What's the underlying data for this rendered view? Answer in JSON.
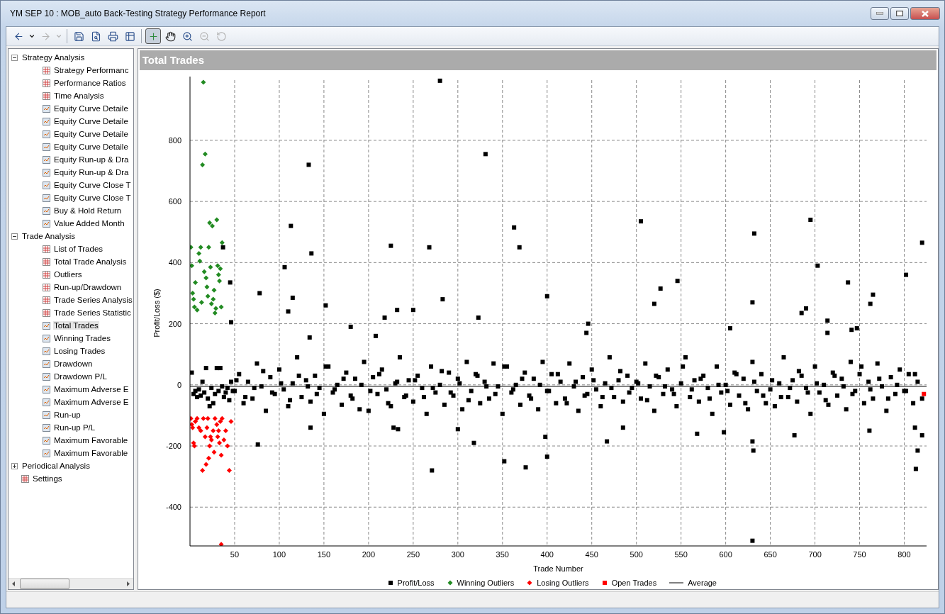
{
  "window": {
    "title": "YM   SEP 10 : MOB_auto Back-Testing Strategy Performance Report"
  },
  "toolbar": [
    {
      "kind": "back",
      "selected": false,
      "disabled": false
    },
    {
      "kind": "dropdown",
      "selected": false,
      "disabled": false
    },
    {
      "kind": "forward",
      "selected": false,
      "disabled": true
    },
    {
      "kind": "dropdown",
      "selected": false,
      "disabled": true
    },
    {
      "kind": "save",
      "selected": false,
      "disabled": false
    },
    {
      "kind": "preview",
      "selected": false,
      "disabled": false
    },
    {
      "kind": "print",
      "selected": false,
      "disabled": false
    },
    {
      "kind": "grid",
      "selected": false,
      "disabled": false
    },
    {
      "kind": "crosshair",
      "selected": true,
      "disabled": false
    },
    {
      "kind": "hand",
      "selected": false,
      "disabled": false
    },
    {
      "kind": "zoom-in",
      "selected": false,
      "disabled": false
    },
    {
      "kind": "zoom-out",
      "selected": false,
      "disabled": true
    },
    {
      "kind": "reset",
      "selected": false,
      "disabled": true
    }
  ],
  "sidebar": {
    "items": [
      {
        "label": "Strategy Analysis",
        "kind": "group",
        "expanded": true,
        "selected": false,
        "children": [
          {
            "label": "Strategy Performanc",
            "kind": "table",
            "selected": false
          },
          {
            "label": "Performance Ratios",
            "kind": "table",
            "selected": false
          },
          {
            "label": "Time Analysis",
            "kind": "table",
            "selected": false
          },
          {
            "label": "Equity Curve Detaile",
            "kind": "chart",
            "selected": false
          },
          {
            "label": "Equity Curve Detaile",
            "kind": "chart",
            "selected": false
          },
          {
            "label": "Equity Curve Detaile",
            "kind": "chart",
            "selected": false
          },
          {
            "label": "Equity Curve Detaile",
            "kind": "chart",
            "selected": false
          },
          {
            "label": "Equity Run-up & Dra",
            "kind": "chart",
            "selected": false
          },
          {
            "label": "Equity Run-up & Dra",
            "kind": "chart",
            "selected": false
          },
          {
            "label": "Equity Curve Close T",
            "kind": "chart",
            "selected": false
          },
          {
            "label": "Equity Curve Close T",
            "kind": "chart",
            "selected": false
          },
          {
            "label": "Buy & Hold Return",
            "kind": "chart",
            "selected": false
          },
          {
            "label": "Value Added Month",
            "kind": "chart",
            "selected": false
          }
        ]
      },
      {
        "label": "Trade Analysis",
        "kind": "group",
        "expanded": true,
        "selected": false,
        "children": [
          {
            "label": "List of Trades",
            "kind": "table",
            "selected": false
          },
          {
            "label": "Total Trade Analysis",
            "kind": "table",
            "selected": false
          },
          {
            "label": "Outliers",
            "kind": "table",
            "selected": false
          },
          {
            "label": "Run-up/Drawdown",
            "kind": "table",
            "selected": false
          },
          {
            "label": "Trade Series Analysis",
            "kind": "table",
            "selected": false
          },
          {
            "label": "Trade Series Statistic",
            "kind": "table",
            "selected": false
          },
          {
            "label": "Total Trades",
            "kind": "chart",
            "selected": true
          },
          {
            "label": "Winning Trades",
            "kind": "chart",
            "selected": false
          },
          {
            "label": "Losing Trades",
            "kind": "chart",
            "selected": false
          },
          {
            "label": "Drawdown",
            "kind": "chart",
            "selected": false
          },
          {
            "label": "Drawdown P/L",
            "kind": "chart",
            "selected": false
          },
          {
            "label": "Maximum Adverse E",
            "kind": "chart",
            "selected": false
          },
          {
            "label": "Maximum Adverse E",
            "kind": "chart",
            "selected": false
          },
          {
            "label": "Run-up",
            "kind": "chart",
            "selected": false
          },
          {
            "label": "Run-up P/L",
            "kind": "chart",
            "selected": false
          },
          {
            "label": "Maximum Favorable",
            "kind": "chart",
            "selected": false
          },
          {
            "label": "Maximum Favorable",
            "kind": "chart",
            "selected": false
          }
        ]
      },
      {
        "label": "Periodical Analysis",
        "kind": "group",
        "expanded": false,
        "selected": false
      },
      {
        "label": "Settings",
        "kind": "table",
        "selected": false
      }
    ]
  },
  "report": {
    "title": "Total Trades",
    "chart_data": {
      "type": "scatter",
      "grid": true,
      "xlabel": "Trade Number",
      "ylabel": "Profit/Loss ($)",
      "xlim": [
        0,
        825
      ],
      "ylim": [
        -527,
        997
      ],
      "xticks": [
        {
          "value": 50,
          "label": "50"
        },
        {
          "value": 100,
          "label": "100"
        },
        {
          "value": 150,
          "label": "150"
        },
        {
          "value": 200,
          "label": "200"
        },
        {
          "value": 250,
          "label": "250"
        },
        {
          "value": 300,
          "label": "300"
        },
        {
          "value": 350,
          "label": "350"
        },
        {
          "value": 400,
          "label": "400"
        },
        {
          "value": 450,
          "label": "450"
        },
        {
          "value": 500,
          "label": "500"
        },
        {
          "value": 550,
          "label": "550"
        },
        {
          "value": 600,
          "label": "600"
        },
        {
          "value": 650,
          "label": "650"
        },
        {
          "value": 700,
          "label": "700"
        },
        {
          "value": 750,
          "label": "750"
        },
        {
          "value": 800,
          "label": "800"
        }
      ],
      "yticks": [
        {
          "value": -400,
          "label": "-400"
        },
        {
          "value": -200,
          "label": "-200"
        },
        {
          "value": 0,
          "label": "0"
        },
        {
          "value": 200,
          "label": "200"
        },
        {
          "value": 400,
          "label": "400"
        },
        {
          "value": 600,
          "label": "600"
        },
        {
          "value": 800,
          "label": "800"
        }
      ],
      "series": [
        {
          "name": "Profit/Loss",
          "color": "#000000",
          "marker": "square",
          "x": [
            2,
            4,
            6,
            8,
            10,
            12,
            14,
            16,
            18,
            20,
            22,
            24,
            26,
            28,
            30,
            32,
            34,
            36,
            38,
            40,
            42,
            44,
            46,
            48,
            37,
            45,
            46,
            50,
            55,
            60,
            65,
            70,
            75,
            80,
            85,
            90,
            95,
            100,
            105,
            110,
            115,
            120,
            125,
            130,
            135,
            140,
            145,
            150,
            155,
            160,
            165,
            170,
            175,
            180,
            185,
            190,
            195,
            200,
            205,
            210,
            215,
            220,
            225,
            230,
            235,
            240,
            245,
            250,
            255,
            260,
            265,
            270,
            275,
            280,
            285,
            290,
            295,
            300,
            305,
            310,
            315,
            320,
            325,
            330,
            335,
            340,
            345,
            350,
            355,
            360,
            365,
            370,
            375,
            380,
            385,
            390,
            395,
            400,
            405,
            410,
            415,
            420,
            425,
            430,
            435,
            440,
            445,
            450,
            455,
            460,
            465,
            470,
            475,
            480,
            485,
            490,
            495,
            500,
            505,
            510,
            515,
            520,
            525,
            530,
            535,
            540,
            545,
            550,
            555,
            560,
            565,
            570,
            575,
            580,
            585,
            590,
            595,
            600,
            605,
            610,
            615,
            620,
            625,
            630,
            635,
            640,
            645,
            650,
            655,
            660,
            665,
            670,
            675,
            680,
            685,
            690,
            695,
            700,
            705,
            710,
            715,
            720,
            725,
            730,
            735,
            740,
            745,
            750,
            755,
            760,
            765,
            770,
            775,
            780,
            785,
            790,
            795,
            800,
            805,
            810,
            815,
            820,
            52,
            62,
            72,
            82,
            92,
            102,
            112,
            122,
            132,
            142,
            152,
            162,
            172,
            182,
            192,
            202,
            212,
            222,
            232,
            242,
            252,
            262,
            272,
            282,
            292,
            302,
            312,
            322,
            332,
            342,
            352,
            362,
            372,
            382,
            392,
            402,
            412,
            422,
            432,
            442,
            452,
            462,
            472,
            482,
            492,
            502,
            512,
            522,
            532,
            542,
            552,
            562,
            572,
            582,
            592,
            602,
            612,
            622,
            632,
            642,
            652,
            662,
            672,
            682,
            692,
            702,
            712,
            722,
            732,
            742,
            752,
            762,
            772,
            782,
            792,
            802,
            812,
            133,
            331,
            113,
            136,
            363,
            369,
            268,
            225,
            283,
            106,
            78,
            110,
            115,
            152,
            505,
            527,
            520,
            546,
            632,
            695,
            703,
            737,
            802,
            820,
            762,
            765,
            400,
            446,
            323,
            280,
            630,
            690,
            685,
            741,
            747,
            714,
            714,
            605,
            444,
            134,
            180,
            208,
            218,
            232,
            250,
            630,
            271,
            352,
            376,
            400,
            318,
            76,
            300,
            398,
            467,
            485,
            568,
            598,
            630,
            631,
            677,
            761,
            813,
            815,
            812,
            820,
            135,
            228,
            233
          ],
          "values": [
            40,
            -30,
            -20,
            -40,
            -15,
            -35,
            10,
            -25,
            55,
            -45,
            -70,
            -10,
            -60,
            -30,
            55,
            -20,
            55,
            -5,
            -40,
            -25,
            -10,
            -50,
            10,
            -20,
            450,
            335,
            205,
            -20,
            35,
            -60,
            10,
            -45,
            70,
            -5,
            -85,
            25,
            -30,
            50,
            -15,
            -70,
            5,
            90,
            -40,
            15,
            -55,
            30,
            -10,
            -95,
            60,
            -25,
            0,
            -65,
            40,
            -35,
            20,
            -80,
            75,
            -85,
            25,
            -30,
            50,
            -15,
            -70,
            5,
            90,
            -40,
            15,
            -55,
            30,
            -10,
            -95,
            60,
            -25,
            0,
            -65,
            40,
            -35,
            20,
            -80,
            75,
            -20,
            35,
            -60,
            10,
            -45,
            70,
            -5,
            -95,
            60,
            -25,
            0,
            -65,
            40,
            -35,
            20,
            -80,
            75,
            -20,
            35,
            -60,
            10,
            -45,
            70,
            -5,
            -85,
            25,
            -30,
            50,
            -15,
            -70,
            5,
            90,
            -40,
            15,
            -55,
            30,
            -10,
            10,
            -45,
            70,
            -5,
            -85,
            25,
            -30,
            50,
            -15,
            -70,
            5,
            90,
            -40,
            15,
            -55,
            30,
            -10,
            -95,
            60,
            -25,
            0,
            -65,
            40,
            -35,
            20,
            -80,
            75,
            -20,
            35,
            -60,
            -15,
            -70,
            5,
            90,
            -40,
            15,
            -55,
            30,
            -10,
            -95,
            60,
            -25,
            0,
            -65,
            40,
            -35,
            20,
            -80,
            75,
            -20,
            35,
            -60,
            10,
            -45,
            70,
            -5,
            -85,
            25,
            -30,
            50,
            -20,
            35,
            -60,
            10,
            -45,
            15,
            -40,
            -10,
            45,
            -25,
            5,
            -50,
            30,
            -5,
            -30,
            60,
            -15,
            20,
            -45,
            0,
            -20,
            35,
            -60,
            10,
            -35,
            15,
            -40,
            -10,
            45,
            -25,
            5,
            -50,
            30,
            -5,
            -30,
            60,
            -15,
            20,
            -45,
            0,
            -20,
            35,
            -60,
            10,
            -35,
            15,
            -40,
            -10,
            45,
            -25,
            5,
            -50,
            30,
            -5,
            -30,
            60,
            -15,
            20,
            -45,
            0,
            -20,
            35,
            -60,
            10,
            -35,
            15,
            -40,
            -10,
            45,
            -25,
            5,
            -50,
            30,
            -5,
            -30,
            60,
            -15,
            20,
            -45,
            0,
            -20,
            35,
            720,
            755,
            520,
            430,
            515,
            450,
            450,
            455,
            280,
            385,
            300,
            240,
            285,
            260,
            535,
            315,
            265,
            340,
            495,
            540,
            390,
            335,
            360,
            465,
            265,
            295,
            290,
            200,
            220,
            995,
            270,
            250,
            235,
            180,
            185,
            210,
            170,
            185,
            170,
            155,
            190,
            160,
            220,
            245,
            245,
            -510,
            -280,
            -250,
            -270,
            -235,
            -190,
            -195,
            -145,
            -170,
            -185,
            -140,
            -160,
            -155,
            -185,
            -215,
            -165,
            -150,
            -275,
            -215,
            -140,
            -165,
            -140,
            -140,
            -145
          ]
        },
        {
          "name": "Winning Outliers",
          "color": "#228b22",
          "marker": "diamond",
          "x": [
            1,
            2,
            3,
            4,
            5,
            6,
            8,
            10,
            11,
            12,
            14,
            15,
            17,
            18,
            19,
            20,
            21,
            22,
            23,
            24,
            26,
            27,
            28,
            29,
            30,
            31,
            32,
            33,
            34,
            35,
            36,
            25,
            16,
            13
          ],
          "values": [
            450,
            390,
            300,
            280,
            255,
            335,
            245,
            430,
            405,
            450,
            720,
            990,
            755,
            350,
            320,
            290,
            450,
            530,
            385,
            265,
            280,
            310,
            235,
            250,
            540,
            390,
            360,
            340,
            380,
            255,
            465,
            520,
            370,
            270
          ]
        },
        {
          "name": "Losing Outliers",
          "color": "#ff0000",
          "marker": "diamond",
          "x": [
            1,
            2,
            3,
            4,
            5,
            6,
            8,
            10,
            12,
            14,
            15,
            17,
            18,
            19,
            20,
            21,
            22,
            23,
            24,
            26,
            27,
            28,
            30,
            31,
            32,
            33,
            34,
            35,
            36,
            38,
            40,
            42,
            44,
            46,
            35
          ],
          "values": [
            -110,
            -130,
            -140,
            -190,
            -200,
            -120,
            -110,
            -140,
            -150,
            -280,
            -110,
            -170,
            -260,
            -140,
            -110,
            -240,
            -200,
            -170,
            -180,
            -150,
            -220,
            -110,
            -130,
            -170,
            -150,
            -190,
            -120,
            -230,
            -110,
            -180,
            -150,
            -200,
            -280,
            -120,
            -522
          ]
        },
        {
          "name": "Open Trades",
          "color": "#ff0000",
          "marker": "square",
          "x": [
            822
          ],
          "values": [
            -30
          ]
        },
        {
          "name": "Average",
          "color": "#000000",
          "type": "line",
          "x": [
            0,
            825
          ],
          "values": [
            -5,
            -5
          ]
        }
      ]
    }
  }
}
